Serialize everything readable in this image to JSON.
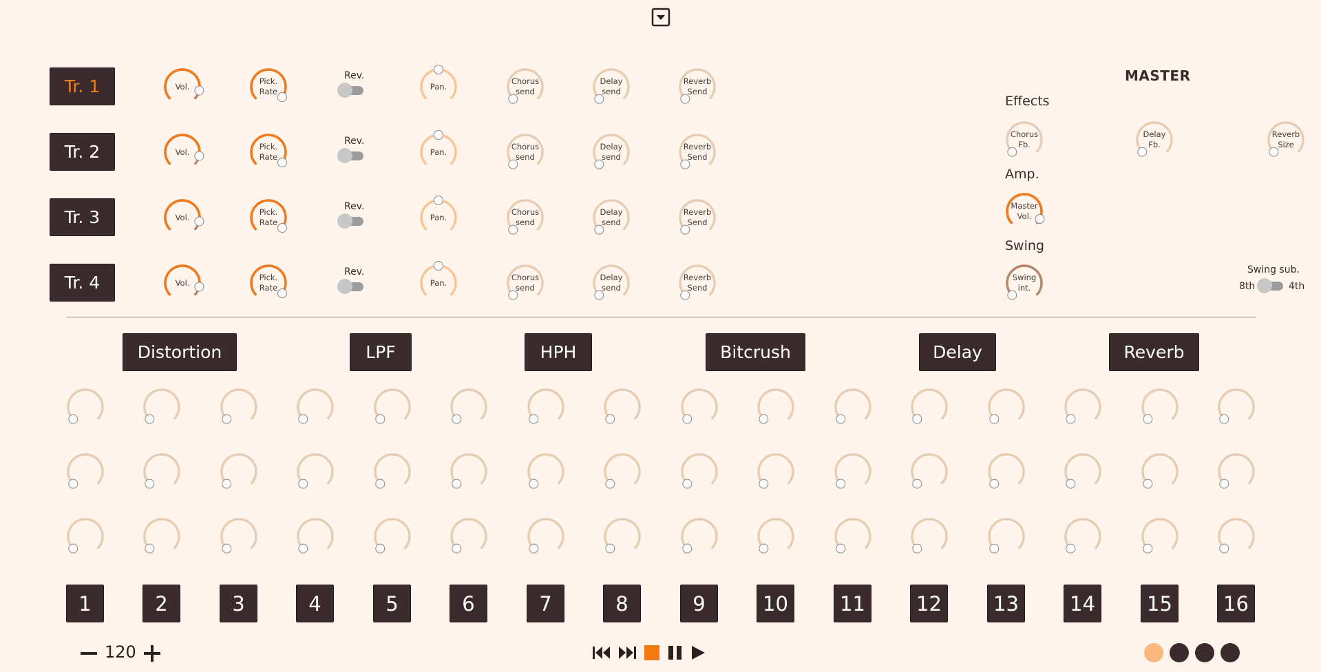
{
  "top": {
    "collapse_icon": "dropdown-toggle-icon"
  },
  "tracks": [
    {
      "label": "Tr. 1",
      "active": true
    },
    {
      "label": "Tr. 2",
      "active": false
    },
    {
      "label": "Tr. 3",
      "active": false
    },
    {
      "label": "Tr. 4",
      "active": false
    }
  ],
  "track_knobs": {
    "vol": "Vol.",
    "pick_rate": "Pick.\nRate",
    "rev": "Rev.",
    "pan": "Pan.",
    "chorus": "Chorus\nsend",
    "delay": "Delay\nsend",
    "reverb": "Reverb\nSend"
  },
  "master": {
    "title": "MASTER",
    "effects_label": "Effects",
    "chorus_fb": "Chorus\nFb.",
    "delay_fb": "Delay\nFb.",
    "reverb_size": "Reverb\nSize",
    "amp_label": "Amp.",
    "master_vol": "Master\nVol.",
    "swing_label": "Swing",
    "swing_int": "Swing\nint.",
    "swing_sub_label": "Swing sub.",
    "swing_8th": "8th",
    "swing_4th": "4th"
  },
  "fx_buttons": [
    "Distortion",
    "LPF",
    "HPH",
    "Bitcrush",
    "Delay",
    "Reverb"
  ],
  "steps": [
    "1",
    "2",
    "3",
    "4",
    "5",
    "6",
    "7",
    "8",
    "9",
    "10",
    "11",
    "12",
    "13",
    "14",
    "15",
    "16"
  ],
  "tempo": {
    "value": "120",
    "minus": "−",
    "plus": "+"
  },
  "transport": [
    "skip-back-icon",
    "skip-forward-icon",
    "stop-icon",
    "pause-icon",
    "play-icon"
  ],
  "patterns": {
    "active_index": 0,
    "count": 4
  },
  "colors": {
    "background": "#fff5ec",
    "dark": "#3b2b2d",
    "orange": "#f07a1e",
    "light_orange": "#f7c79a",
    "tan": "#e8cdb5",
    "brown": "#b8866a"
  }
}
